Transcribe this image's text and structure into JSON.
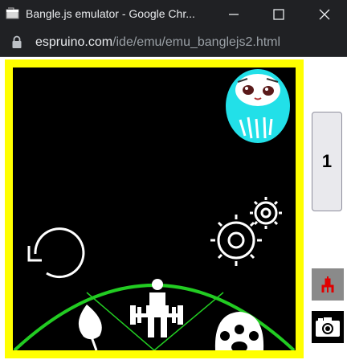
{
  "window": {
    "title": "Bangle.js emulator - Google Chr...",
    "minimize": "minimize",
    "maximize": "maximize",
    "close": "close"
  },
  "address_bar": {
    "url_host": "espruino.com",
    "url_path": "/ide/emu/emu_banglejs2.html"
  },
  "emulator": {
    "hw_button_label": "1",
    "tools": [
      "chart-icon",
      "camera-icon"
    ]
  },
  "colors": {
    "frame": "#ffff00",
    "screen": "#000000",
    "arc": "#22cc22",
    "blob": "#22e0e8"
  }
}
